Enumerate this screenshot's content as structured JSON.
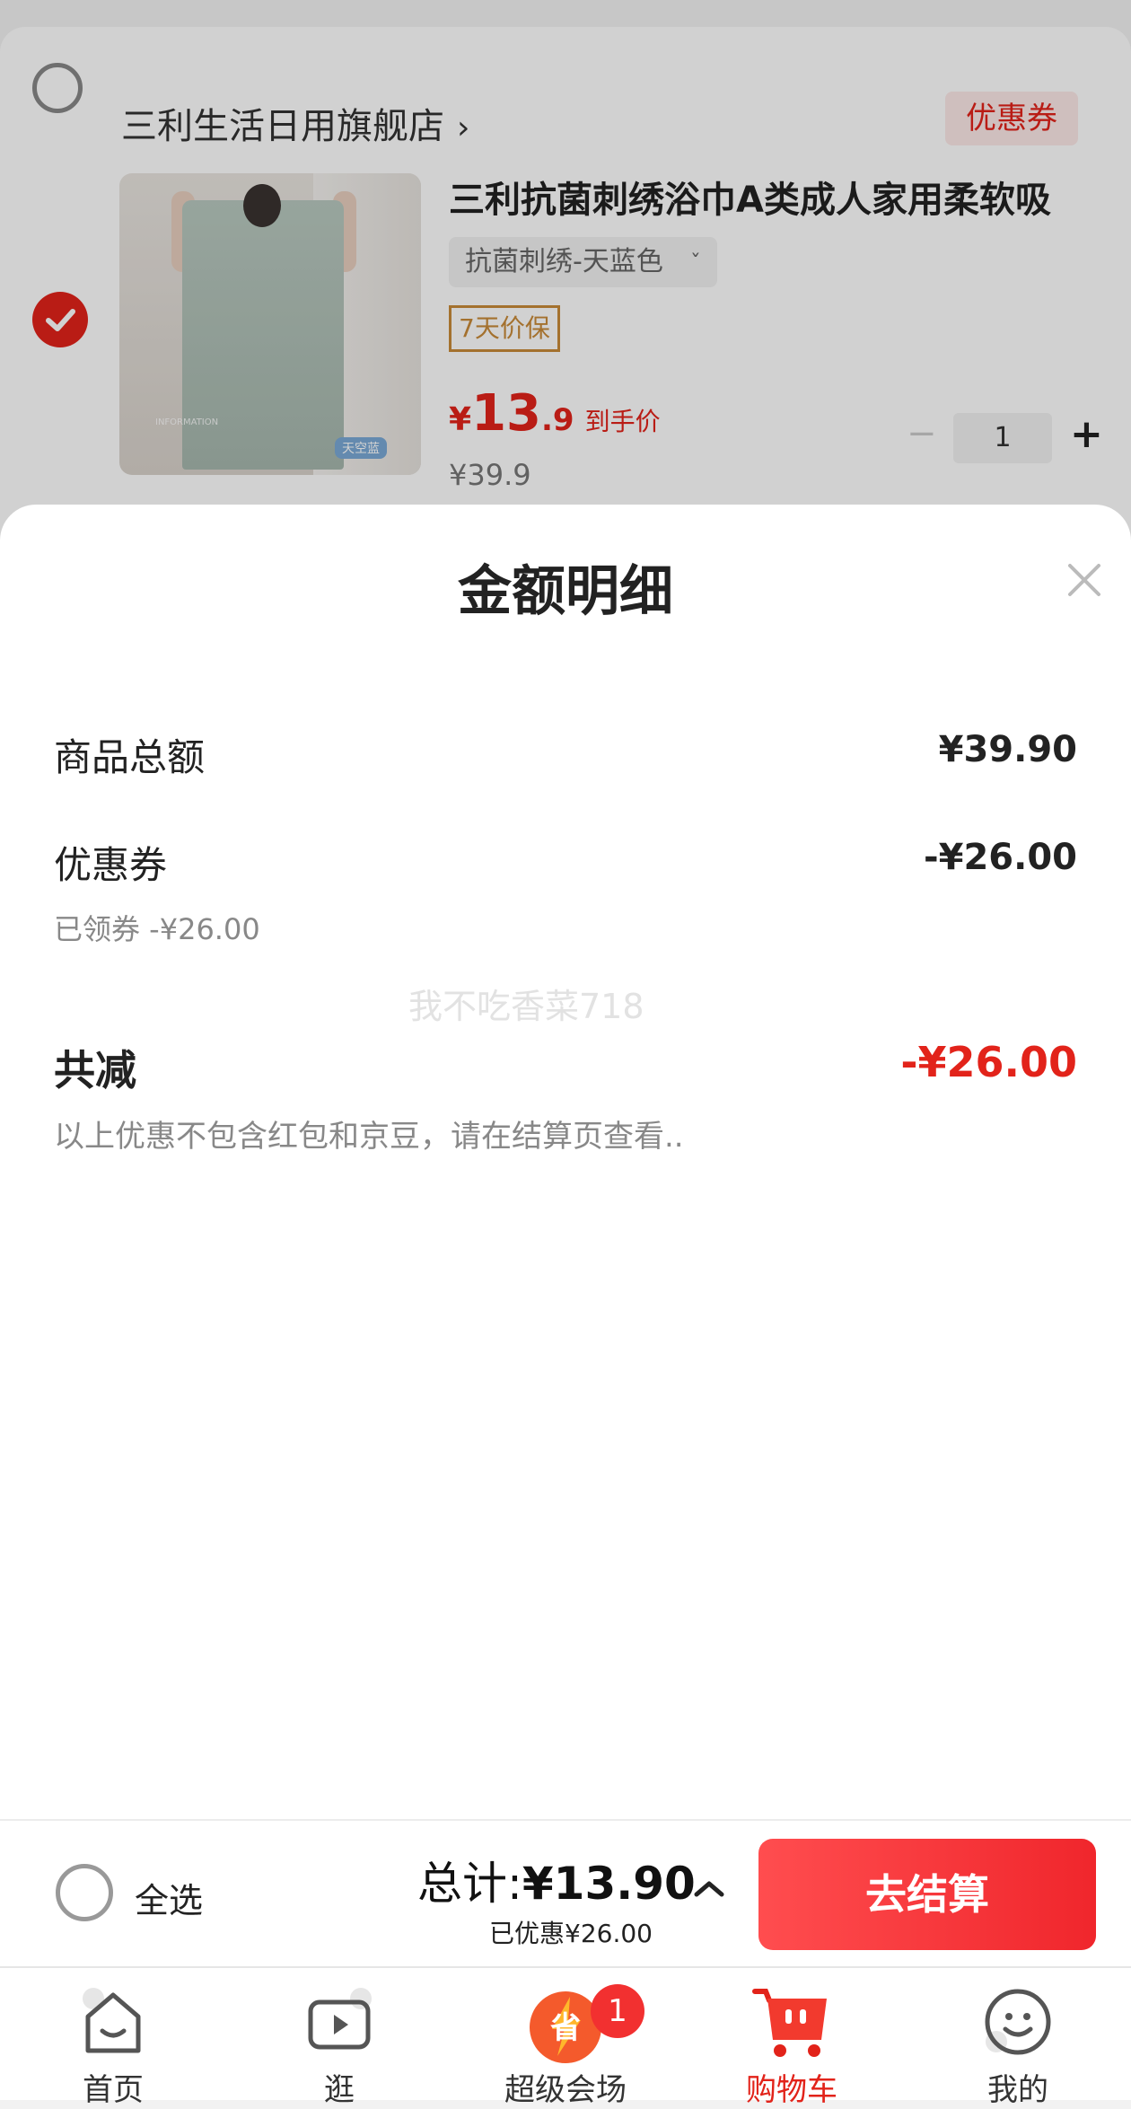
{
  "store": {
    "name": "三利生活日用旗舰店",
    "coupon_label": "优惠券"
  },
  "product": {
    "title": "三利抗菌刺绣浴巾A类成人家用柔软吸",
    "sku": "抗菌刺绣-天蓝色",
    "price_protect": "7天价保",
    "price_yen": "¥",
    "price_int": "13",
    "price_dec": ".9",
    "price_label": "到手价",
    "original_price": "¥39.9",
    "quantity": "1",
    "image_badge": "天空蓝",
    "image_info": "INFORMATION"
  },
  "sheet": {
    "title": "金额明细",
    "rows": {
      "goods_total_label": "商品总额",
      "goods_total_value": "¥39.90",
      "coupon_label": "优惠券",
      "coupon_value": "-¥26.00",
      "coupon_sub": "已领券 -¥26.00",
      "total_reduce_label": "共减",
      "total_reduce_value": "-¥26.00"
    },
    "watermark": "我不吃香菜718",
    "note": "以上优惠不包含红包和京豆，请在结算页查看.."
  },
  "checkout": {
    "select_all": "全选",
    "total_prefix": "总计:",
    "total_value": "¥13.90",
    "saved": "已优惠¥26.00",
    "button": "去结算"
  },
  "nav": {
    "items": [
      {
        "label": "首页",
        "icon": "home-icon"
      },
      {
        "label": "逛",
        "icon": "video-icon"
      },
      {
        "label": "超级会场",
        "icon": "super-venue-icon"
      },
      {
        "label": "购物车",
        "icon": "cart-icon"
      },
      {
        "label": "我的",
        "icon": "profile-icon"
      }
    ],
    "badge": "1",
    "active_index": 3
  },
  "colors": {
    "accent": "#e2231a",
    "button": "#f0262c"
  }
}
